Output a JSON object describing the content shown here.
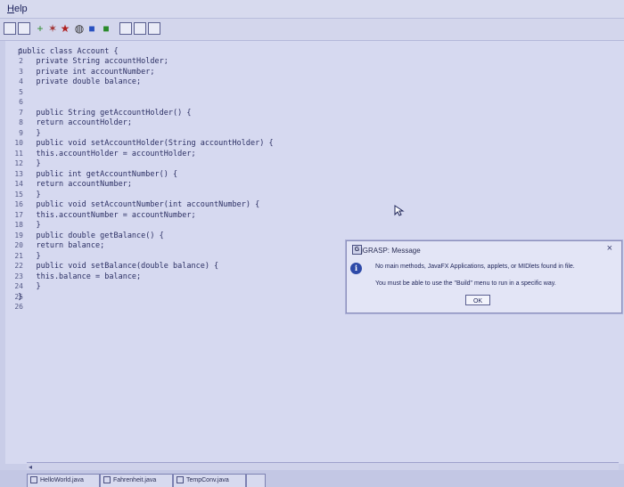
{
  "menubar": {
    "help_label": "Help"
  },
  "toolbar": {
    "icons": [
      "new-file-icon",
      "open-icon",
      "add-icon",
      "remove-icon",
      "run-icon",
      "debug-icon",
      "step-icon",
      "stop-icon",
      "window-icon",
      "copy-icon",
      "find-icon",
      "help-icon"
    ]
  },
  "editor": {
    "line_numbers": [
      "1",
      "2",
      "3",
      "4",
      "5",
      "6",
      "7",
      "8",
      "9",
      "10",
      "11",
      "12",
      "13",
      "14",
      "15",
      "16",
      "17",
      "18",
      "19",
      "20",
      "21",
      "22",
      "23",
      "24",
      "25",
      "26"
    ],
    "lines": [
      "public class Account {",
      "    private String accountHolder;",
      "    private int accountNumber;",
      "    private double balance;",
      "",
      "",
      "    public String getAccountHolder() {",
      "    return accountHolder;",
      "    }",
      "    public void setAccountHolder(String accountHolder) {",
      "    this.accountHolder = accountHolder;",
      "    }",
      "    public int getAccountNumber() {",
      "    return accountNumber;",
      "    }",
      "    public void setAccountNumber(int accountNumber) {",
      "    this.accountNumber = accountNumber;",
      "    }",
      "    public double getBalance() {",
      "    return balance;",
      "    }",
      "    public void setBalance(double balance) {",
      "    this.balance = balance;",
      "    }",
      "}",
      ""
    ]
  },
  "dialog": {
    "title": "jGRASP: Message",
    "logo": "G",
    "close": "×",
    "info_glyph": "i",
    "message1": "No main methods, JavaFX Applications, applets, or MIDlets found in file.",
    "message2": "You must be able to use the \"Build\" menu to run in a specific way.",
    "ok_label": "OK"
  },
  "tabs": [
    {
      "label": "HelloWorld.java"
    },
    {
      "label": "Fahrenheit.java"
    },
    {
      "label": "TempConv.java"
    },
    {
      "label": ""
    }
  ],
  "colors": {
    "background": "#c9cde8",
    "info_icon": "#2e4aa8"
  }
}
